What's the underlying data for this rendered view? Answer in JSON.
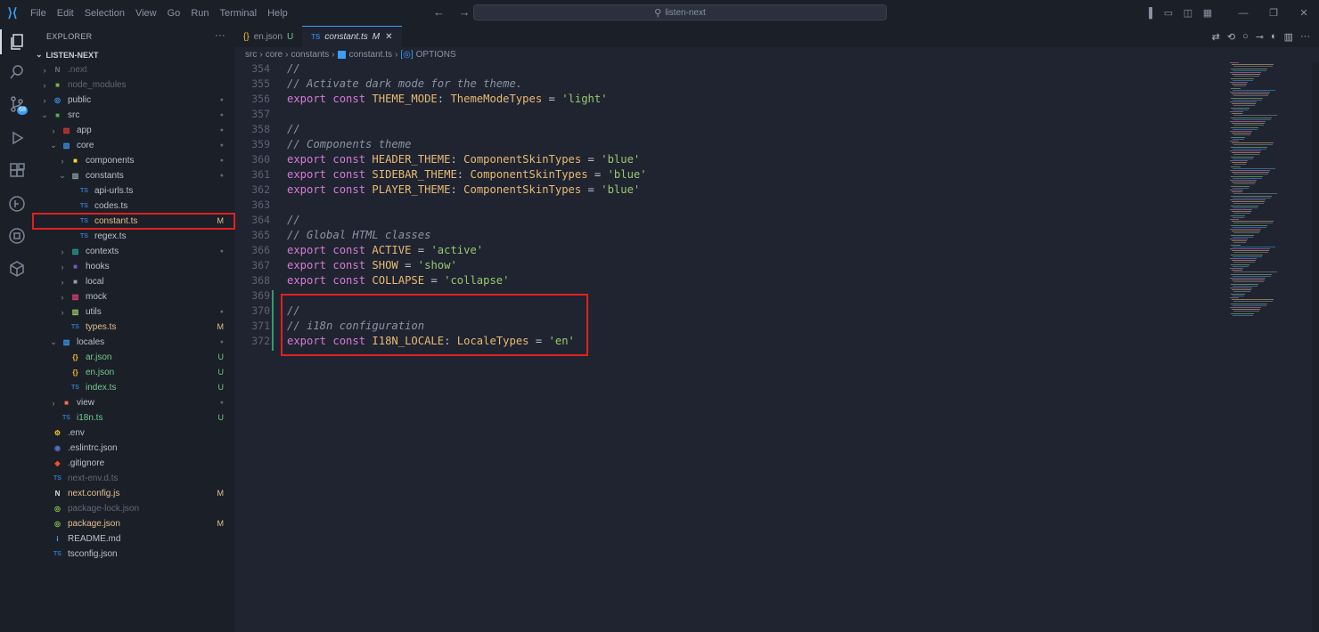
{
  "titlebar": {
    "menu": [
      "File",
      "Edit",
      "Selection",
      "View",
      "Go",
      "Run",
      "Terminal",
      "Help"
    ],
    "search": "listen-next",
    "nav": "← →"
  },
  "activity": {
    "items": [
      "explorer-icon",
      "search-icon",
      "source-control-icon",
      "run-debug-icon",
      "extensions-icon",
      "git-graph-icon",
      "remote-icon",
      "containers-icon"
    ],
    "scm_badge": "68"
  },
  "sidebar": {
    "title": "EXPLORER",
    "more": "···",
    "root": "LISTEN-NEXT",
    "tree": [
      {
        "depth": 0,
        "chev": "›",
        "icon": "N",
        "icon_color": "#6a7486",
        "label": ".next",
        "dim": true,
        "status": ""
      },
      {
        "depth": 0,
        "chev": "›",
        "icon": "■",
        "icon_color": "#7cb342",
        "label": "node_modules",
        "dim": true,
        "status": ""
      },
      {
        "depth": 0,
        "chev": "›",
        "icon": "◎",
        "icon_color": "#3c9df2",
        "label": "public",
        "dim": false,
        "status": "●"
      },
      {
        "depth": 0,
        "chev": "⌄",
        "icon": "■",
        "icon_color": "#4caf50",
        "label": "src",
        "dim": false,
        "status": "●"
      },
      {
        "depth": 1,
        "chev": "›",
        "icon": "▥",
        "icon_color": "#e53935",
        "label": "app",
        "dim": false,
        "status": "●"
      },
      {
        "depth": 1,
        "chev": "⌄",
        "icon": "▥",
        "icon_color": "#3c9df2",
        "label": "core",
        "dim": false,
        "status": "●"
      },
      {
        "depth": 2,
        "chev": "›",
        "icon": "■",
        "icon_color": "#fdd835",
        "label": "components",
        "dim": false,
        "status": "●"
      },
      {
        "depth": 2,
        "chev": "⌄",
        "icon": "▥",
        "icon_color": "#90a4ae",
        "label": "constants",
        "dim": false,
        "status": "●"
      },
      {
        "depth": 3,
        "chev": "",
        "icon": "TS",
        "icon_color": "#3178c6",
        "label": "api-urls.ts",
        "dim": false,
        "status": ""
      },
      {
        "depth": 3,
        "chev": "",
        "icon": "TS",
        "icon_color": "#3178c6",
        "label": "codes.ts",
        "dim": false,
        "status": ""
      },
      {
        "depth": 3,
        "chev": "",
        "icon": "TS",
        "icon_color": "#3178c6",
        "label": "constant.ts",
        "dim": false,
        "status": "M",
        "selected": true
      },
      {
        "depth": 3,
        "chev": "",
        "icon": "TS",
        "icon_color": "#3178c6",
        "label": "regex.ts",
        "dim": false,
        "status": ""
      },
      {
        "depth": 2,
        "chev": "›",
        "icon": "▥",
        "icon_color": "#26a69a",
        "label": "contexts",
        "dim": false,
        "status": "●"
      },
      {
        "depth": 2,
        "chev": "›",
        "icon": "■",
        "icon_color": "#7e57c2",
        "label": "hooks",
        "dim": false,
        "status": ""
      },
      {
        "depth": 2,
        "chev": "›",
        "icon": "■",
        "icon_color": "#90a4ae",
        "label": "local",
        "dim": false,
        "status": ""
      },
      {
        "depth": 2,
        "chev": "›",
        "icon": "▥",
        "icon_color": "#ec407a",
        "label": "mock",
        "dim": false,
        "status": ""
      },
      {
        "depth": 2,
        "chev": "›",
        "icon": "▥",
        "icon_color": "#9ccc65",
        "label": "utils",
        "dim": false,
        "status": "●"
      },
      {
        "depth": 2,
        "chev": "",
        "icon": "TS",
        "icon_color": "#3178c6",
        "label": "types.ts",
        "dim": false,
        "status": "M"
      },
      {
        "depth": 1,
        "chev": "⌄",
        "icon": "▥",
        "icon_color": "#3c9df2",
        "label": "locales",
        "dim": false,
        "status": "●"
      },
      {
        "depth": 2,
        "chev": "",
        "icon": "{}",
        "icon_color": "#fbc02d",
        "label": "ar.json",
        "dim": false,
        "status": "U"
      },
      {
        "depth": 2,
        "chev": "",
        "icon": "{}",
        "icon_color": "#fbc02d",
        "label": "en.json",
        "dim": false,
        "status": "U"
      },
      {
        "depth": 2,
        "chev": "",
        "icon": "TS",
        "icon_color": "#3178c6",
        "label": "index.ts",
        "dim": false,
        "status": "U"
      },
      {
        "depth": 1,
        "chev": "›",
        "icon": "■",
        "icon_color": "#ff7043",
        "label": "view",
        "dim": false,
        "status": "●"
      },
      {
        "depth": 1,
        "chev": "",
        "icon": "TS",
        "icon_color": "#3178c6",
        "label": "i18n.ts",
        "dim": false,
        "status": "U"
      },
      {
        "depth": 0,
        "chev": "",
        "icon": "⚙",
        "icon_color": "#fbc02d",
        "label": ".env",
        "dim": false,
        "status": ""
      },
      {
        "depth": 0,
        "chev": "",
        "icon": "◉",
        "icon_color": "#5c6bc0",
        "label": ".eslintrc.json",
        "dim": false,
        "status": ""
      },
      {
        "depth": 0,
        "chev": "",
        "icon": "◆",
        "icon_color": "#f4511e",
        "label": ".gitignore",
        "dim": false,
        "status": ""
      },
      {
        "depth": 0,
        "chev": "",
        "icon": "TS",
        "icon_color": "#3178c6",
        "label": "next-env.d.ts",
        "dim": true,
        "status": ""
      },
      {
        "depth": 0,
        "chev": "",
        "icon": "N",
        "icon_color": "#e0e0e0",
        "label": "next.config.js",
        "dim": false,
        "status": "M"
      },
      {
        "depth": 0,
        "chev": "",
        "icon": "◎",
        "icon_color": "#8bc34a",
        "label": "package-lock.json",
        "dim": true,
        "status": ""
      },
      {
        "depth": 0,
        "chev": "",
        "icon": "◎",
        "icon_color": "#8bc34a",
        "label": "package.json",
        "dim": false,
        "status": "M"
      },
      {
        "depth": 0,
        "chev": "",
        "icon": "i",
        "icon_color": "#42a5f5",
        "label": "README.md",
        "dim": false,
        "status": ""
      },
      {
        "depth": 0,
        "chev": "",
        "icon": "TS",
        "icon_color": "#3178c6",
        "label": "tsconfig.json",
        "dim": false,
        "status": ""
      }
    ]
  },
  "tabs": [
    {
      "icon": "{}",
      "label": "en.json",
      "modifier": "U",
      "close": "",
      "active": false
    },
    {
      "icon": "TS",
      "label": "constant.ts",
      "modifier": "M",
      "close": "✕",
      "active": true
    }
  ],
  "editor_actions": [
    "⇄",
    "⟲",
    "○",
    "⊸",
    "◐",
    "▥",
    "···"
  ],
  "breadcrumb": [
    "src",
    "core",
    "constants",
    "constant.ts",
    "OPTIONS"
  ],
  "code": [
    {
      "n": "354",
      "tokens": [
        [
          "c",
          "//"
        ]
      ]
    },
    {
      "n": "355",
      "tokens": [
        [
          "c",
          "// Activate dark mode for the theme."
        ]
      ]
    },
    {
      "n": "356",
      "tokens": [
        [
          "k",
          "export const "
        ],
        [
          "id",
          "THEME_MODE"
        ],
        [
          "p",
          ": "
        ],
        [
          "ty",
          "ThemeModeTypes"
        ],
        [
          "p",
          " = "
        ],
        [
          "s",
          "'light'"
        ]
      ]
    },
    {
      "n": "357",
      "tokens": []
    },
    {
      "n": "358",
      "tokens": [
        [
          "c",
          "//"
        ]
      ]
    },
    {
      "n": "359",
      "tokens": [
        [
          "c",
          "// Components theme"
        ]
      ]
    },
    {
      "n": "360",
      "tokens": [
        [
          "k",
          "export const "
        ],
        [
          "id",
          "HEADER_THEME"
        ],
        [
          "p",
          ": "
        ],
        [
          "ty",
          "ComponentSkinTypes"
        ],
        [
          "p",
          " = "
        ],
        [
          "s",
          "'blue'"
        ]
      ]
    },
    {
      "n": "361",
      "tokens": [
        [
          "k",
          "export const "
        ],
        [
          "id",
          "SIDEBAR_THEME"
        ],
        [
          "p",
          ": "
        ],
        [
          "ty",
          "ComponentSkinTypes"
        ],
        [
          "p",
          " = "
        ],
        [
          "s",
          "'blue'"
        ]
      ]
    },
    {
      "n": "362",
      "tokens": [
        [
          "k",
          "export const "
        ],
        [
          "id",
          "PLAYER_THEME"
        ],
        [
          "p",
          ": "
        ],
        [
          "ty",
          "ComponentSkinTypes"
        ],
        [
          "p",
          " = "
        ],
        [
          "s",
          "'blue'"
        ]
      ]
    },
    {
      "n": "363",
      "tokens": []
    },
    {
      "n": "364",
      "tokens": [
        [
          "c",
          "//"
        ]
      ]
    },
    {
      "n": "365",
      "tokens": [
        [
          "c",
          "// Global HTML classes"
        ]
      ]
    },
    {
      "n": "366",
      "tokens": [
        [
          "k",
          "export const "
        ],
        [
          "id",
          "ACTIVE"
        ],
        [
          "p",
          " = "
        ],
        [
          "s",
          "'active'"
        ]
      ]
    },
    {
      "n": "367",
      "tokens": [
        [
          "k",
          "export const "
        ],
        [
          "id",
          "SHOW"
        ],
        [
          "p",
          " = "
        ],
        [
          "s",
          "'show'"
        ]
      ]
    },
    {
      "n": "368",
      "tokens": [
        [
          "k",
          "export const "
        ],
        [
          "id",
          "COLLAPSE"
        ],
        [
          "p",
          " = "
        ],
        [
          "s",
          "'collapse'"
        ]
      ]
    },
    {
      "n": "369",
      "tokens": []
    },
    {
      "n": "370",
      "tokens": [
        [
          "c",
          "//"
        ]
      ]
    },
    {
      "n": "371",
      "tokens": [
        [
          "c",
          "// i18n configuration"
        ]
      ]
    },
    {
      "n": "372",
      "tokens": [
        [
          "k",
          "export const "
        ],
        [
          "id",
          "I18N_LOCALE"
        ],
        [
          "p",
          ": "
        ],
        [
          "ty",
          "LocaleTypes"
        ],
        [
          "p",
          " = "
        ],
        [
          "s",
          "'en'"
        ]
      ]
    }
  ],
  "colors": {
    "accent": "#3c9df2",
    "highlight_box": "#e02020",
    "modified": "#e2c08d",
    "untracked": "#73c991"
  }
}
